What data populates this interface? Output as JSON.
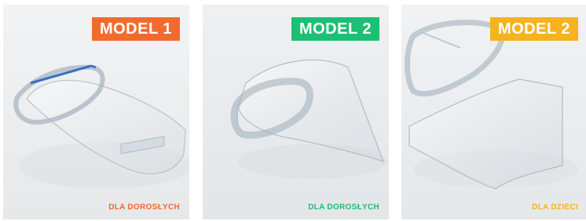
{
  "colors": {
    "orange": "#f26b2e",
    "green": "#1cbf73",
    "yellow": "#f6b31f",
    "card_bg_1": "#eef0f2",
    "card_bg_2": "#e9ebed",
    "card_bg_3": "#edeff1"
  },
  "cards": [
    {
      "badge": "MODEL 1",
      "caption": "DLA DOROSŁYCH",
      "image_icon": "face-shield-model-1-image"
    },
    {
      "badge": "MODEL 2",
      "caption": "DLA DOROSŁYCH",
      "image_icon": "face-shield-model-2-image"
    },
    {
      "badge": "MODEL 2",
      "caption": "DLA DZIECI",
      "image_icon": "face-shield-model-2-kids-image"
    }
  ]
}
